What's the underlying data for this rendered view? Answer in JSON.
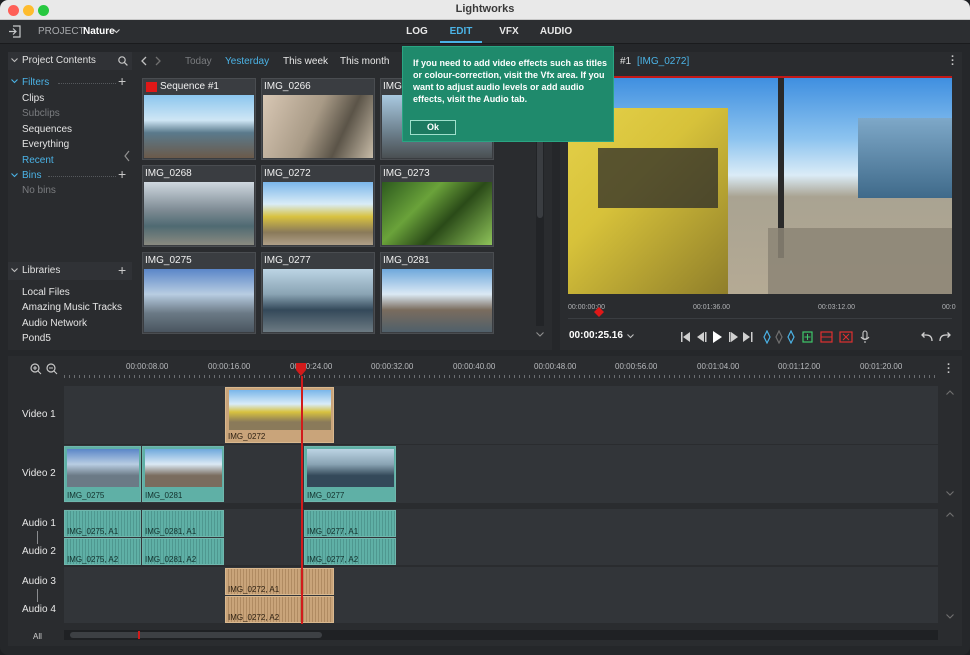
{
  "window": {
    "title": "Lightworks"
  },
  "topbar": {
    "project_label": "PROJECT",
    "project_name": "Nature",
    "tabs": [
      "LOG",
      "EDIT",
      "VFX",
      "AUDIO"
    ],
    "active_tab": "EDIT"
  },
  "sidebar": {
    "project_contents": "Project Contents",
    "filters": "Filters",
    "filter_items": [
      "Clips",
      "Subclips",
      "Sequences",
      "Everything",
      "Recent"
    ],
    "bins": "Bins",
    "no_bins": "No bins",
    "libraries": "Libraries",
    "library_items": [
      "Local Files",
      "Amazing Music Tracks",
      "Audio Network",
      "Pond5"
    ]
  },
  "browser": {
    "date_tabs": [
      "Today",
      "Yesterday",
      "This week",
      "This month"
    ],
    "active_date_tab": "Yesterday",
    "thumbs": [
      "Sequence #1",
      "IMG_0266",
      "IMG",
      "IMG_0268",
      "IMG_0272",
      "IMG_0273",
      "IMG_0275",
      "IMG_0277",
      "IMG_0281"
    ]
  },
  "viewer": {
    "title_suffix": "#1",
    "clip_name": "[IMG_0272]",
    "ruler": [
      "00:00:00:00",
      "00:01:36.00",
      "00:03:12.00",
      "00:0"
    ],
    "timecode": "00:00:25.16"
  },
  "popup": {
    "text": "If you need to add video effects such as titles or colour-correction, visit the Vfx area.  If you want to adjust audio levels or add audio effects, visit the Audio tab.",
    "ok": "Ok"
  },
  "timeline": {
    "ruler": [
      "00:00:08.00",
      "00:00:16.00",
      "00:00:24.00",
      "00:00:32.00",
      "00:00:40.00",
      "00:00:48.00",
      "00:00:56.00",
      "00:01:04.00",
      "00:01:12.00",
      "00:01:20.00"
    ],
    "tracks": [
      "Video 1",
      "Video 2",
      "Audio 1",
      "Audio 2",
      "Audio 3",
      "Audio 4"
    ],
    "clips": {
      "v1": "IMG_0272",
      "v2a": "IMG_0275",
      "v2b": "IMG_0281",
      "v2c": "IMG_0277",
      "a1a": "IMG_0275, A1",
      "a1b": "IMG_0281, A1",
      "a1c": "IMG_0277, A1",
      "a2a": "IMG_0275, A2",
      "a2b": "IMG_0281, A2",
      "a2c": "IMG_0277, A2",
      "a3": "IMG_0272, A1",
      "a4": "IMG_0272, A2"
    },
    "all_label": "All"
  },
  "colors": {
    "accent": "#4bb3e6",
    "popup": "#1f8a6c",
    "clip_teal": "#5fb0a6",
    "clip_tan": "#c9a47a",
    "playhead": "#d11b1b"
  }
}
